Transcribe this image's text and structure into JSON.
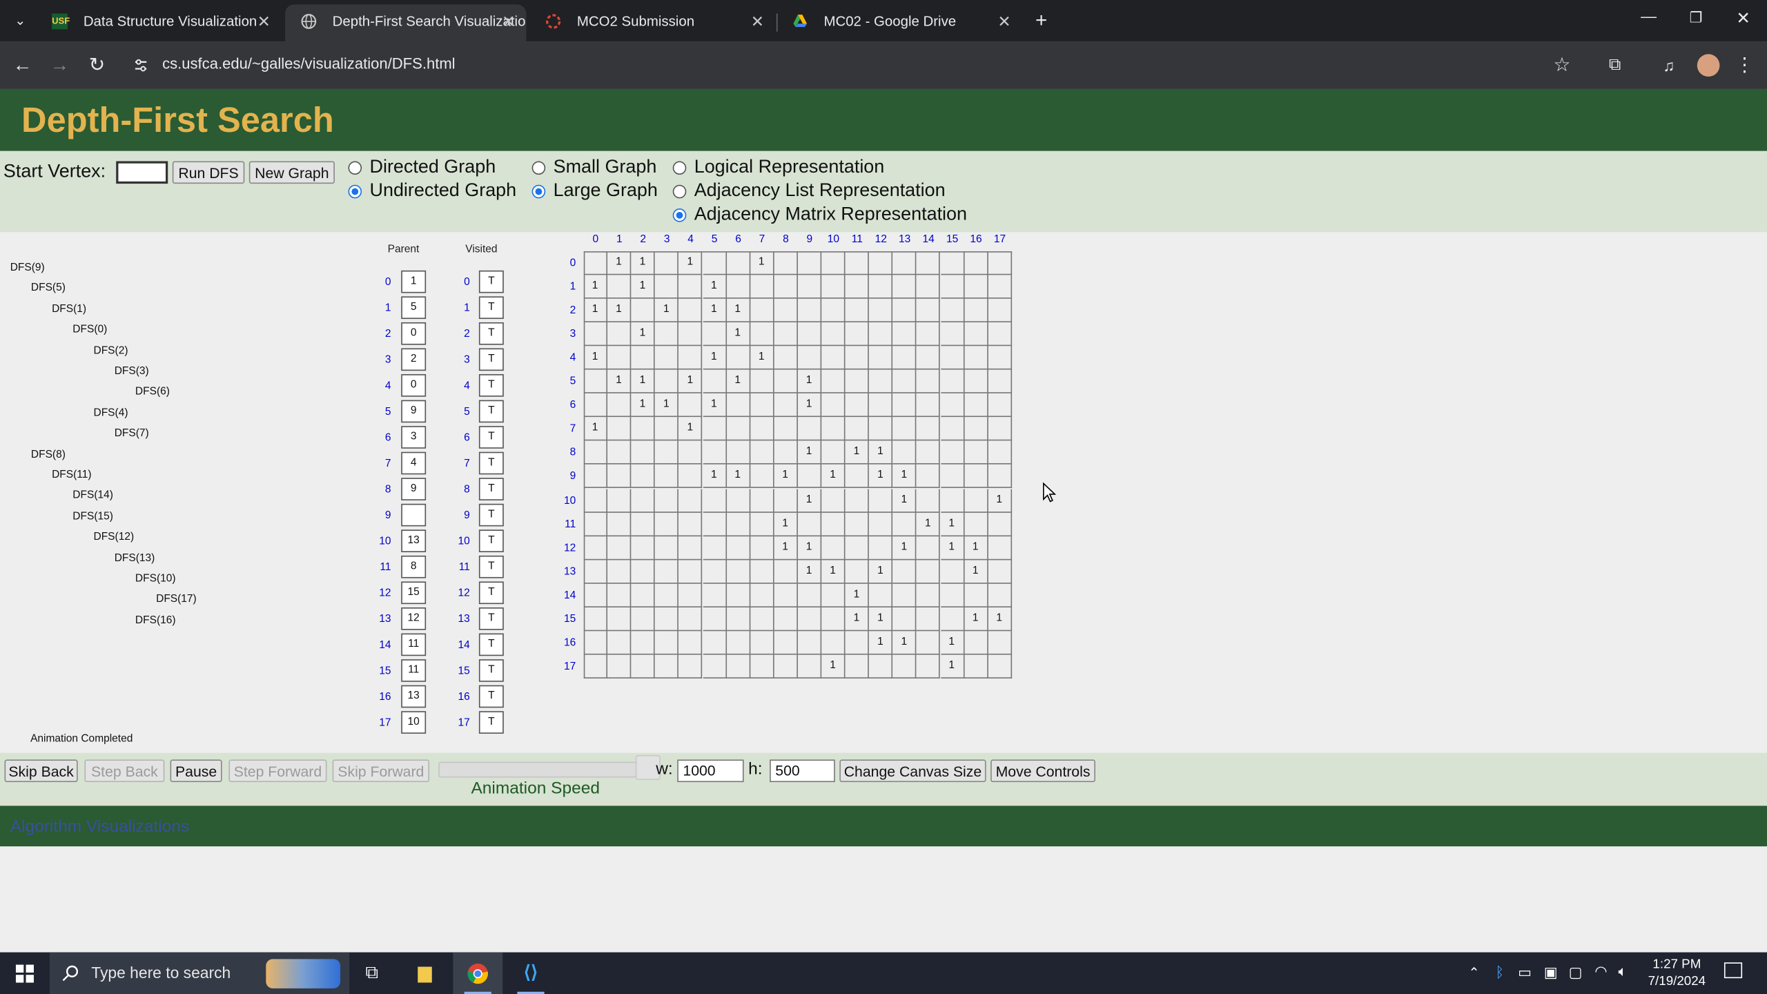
{
  "browser": {
    "tabs": [
      {
        "title": "Data Structure Visualization",
        "active": false,
        "icon": "usf-logo-icon"
      },
      {
        "title": "Depth-First Search Visualization",
        "active": true,
        "icon": "globe-icon"
      },
      {
        "title": "MCO2 Submission",
        "active": false,
        "icon": "form-icon"
      },
      {
        "title": "MC02 - Google Drive",
        "active": false,
        "icon": "drive-icon"
      }
    ],
    "url": "cs.usfca.edu/~galles/visualization/DFS.html"
  },
  "page": {
    "title": "Depth-First Search",
    "start_vertex_label": "Start Vertex:",
    "start_vertex_value": "",
    "run_button": "Run DFS",
    "new_graph_button": "New Graph",
    "options": {
      "directed": "Directed Graph",
      "undirected": "Undirected Graph",
      "small": "Small Graph",
      "large": "Large Graph",
      "logical": "Logical Representation",
      "adj_list": "Adjacency List Representation",
      "adj_matrix": "Adjacency Matrix Representation"
    },
    "selected": {
      "graph_type": "undirected",
      "graph_size": "large",
      "representation": "adj_matrix"
    }
  },
  "canvas": {
    "dfs_calls": [
      {
        "label": "DFS(9)",
        "depth": 0
      },
      {
        "label": "DFS(5)",
        "depth": 1
      },
      {
        "label": "DFS(1)",
        "depth": 2
      },
      {
        "label": "DFS(0)",
        "depth": 3
      },
      {
        "label": "DFS(2)",
        "depth": 4
      },
      {
        "label": "DFS(3)",
        "depth": 5
      },
      {
        "label": "DFS(6)",
        "depth": 6
      },
      {
        "label": "DFS(4)",
        "depth": 4
      },
      {
        "label": "DFS(7)",
        "depth": 5
      },
      {
        "label": "DFS(8)",
        "depth": 1
      },
      {
        "label": "DFS(11)",
        "depth": 2
      },
      {
        "label": "DFS(14)",
        "depth": 3
      },
      {
        "label": "DFS(15)",
        "depth": 3
      },
      {
        "label": "DFS(12)",
        "depth": 4
      },
      {
        "label": "DFS(13)",
        "depth": 5
      },
      {
        "label": "DFS(10)",
        "depth": 6
      },
      {
        "label": "DFS(17)",
        "depth": 7
      },
      {
        "label": "DFS(16)",
        "depth": 6
      }
    ],
    "parent_header": "Parent",
    "visited_header": "Visited",
    "parent": [
      "1",
      "5",
      "0",
      "2",
      "0",
      "9",
      "3",
      "4",
      "9",
      "",
      "13",
      "8",
      "15",
      "12",
      "11",
      "11",
      "13",
      "10"
    ],
    "visited": [
      "T",
      "T",
      "T",
      "T",
      "T",
      "T",
      "T",
      "T",
      "T",
      "T",
      "T",
      "T",
      "T",
      "T",
      "T",
      "T",
      "T",
      "T"
    ],
    "matrix_size": 18,
    "matrix_rows": [
      [
        1,
        2,
        4,
        7
      ],
      [
        0,
        2,
        5
      ],
      [
        0,
        1,
        3,
        5,
        6
      ],
      [
        2,
        6
      ],
      [
        0,
        5,
        7
      ],
      [
        1,
        2,
        4,
        6,
        9
      ],
      [
        2,
        3,
        5,
        9
      ],
      [
        0,
        4
      ],
      [
        9,
        11,
        12
      ],
      [
        5,
        6,
        8,
        10,
        12,
        13
      ],
      [
        9,
        13,
        17
      ],
      [
        8,
        14,
        15
      ],
      [
        8,
        9,
        13,
        15,
        16
      ],
      [
        9,
        10,
        12,
        16
      ],
      [
        11
      ],
      [
        11,
        12,
        16,
        17
      ],
      [
        12,
        13,
        15
      ],
      [
        10,
        15
      ]
    ],
    "status": "Animation Completed"
  },
  "bottom_controls": {
    "skip_back": "Skip Back",
    "step_back": "Step Back",
    "pause": "Pause",
    "step_forward": "Step Forward",
    "skip_forward": "Skip Forward",
    "speed_label": "Animation Speed",
    "width_label": "w:",
    "width_value": "1000",
    "height_label": "h:",
    "height_value": "500",
    "change_size": "Change Canvas Size",
    "move_controls": "Move Controls"
  },
  "footer": {
    "link": "Algorithm Visualizations"
  },
  "taskbar": {
    "search_placeholder": "Type here to search",
    "time": "1:27 PM",
    "date": "7/19/2024"
  },
  "colors": {
    "header_green": "#2a5b32",
    "title_gold": "#e3b34f",
    "controls_bg": "#d8e3d3"
  }
}
